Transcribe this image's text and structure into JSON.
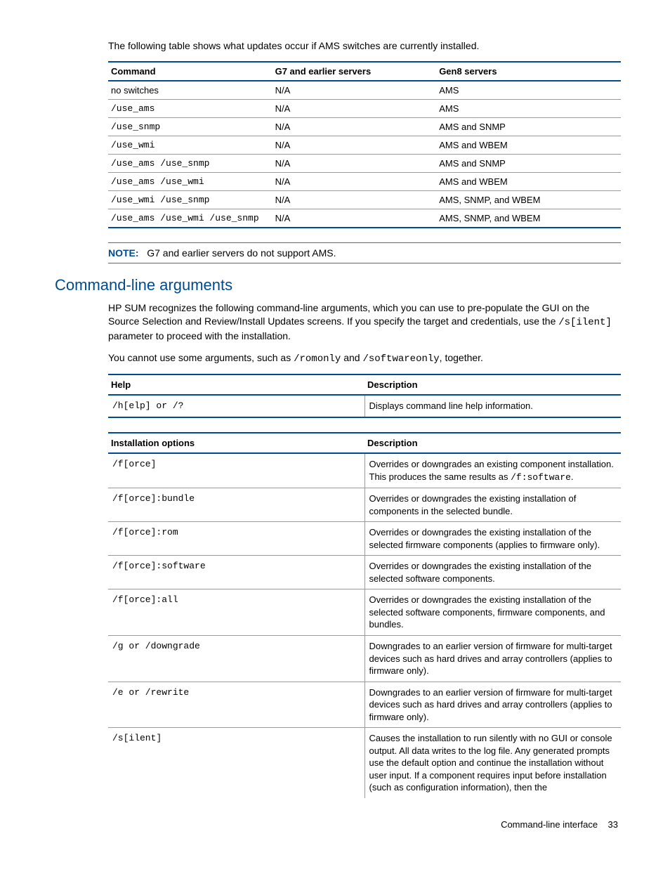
{
  "intro_text": "The following table shows what updates occur if AMS switches are currently installed.",
  "ams_table": {
    "headers": [
      "Command",
      "G7 and earlier servers",
      "Gen8 servers"
    ],
    "rows": [
      {
        "cmd": "no switches",
        "cmd_mono": false,
        "g7": "N/A",
        "gen8": "AMS"
      },
      {
        "cmd": "/use_ams",
        "cmd_mono": true,
        "g7": "N/A",
        "gen8": "AMS"
      },
      {
        "cmd": "/use_snmp",
        "cmd_mono": true,
        "g7": "N/A",
        "gen8": "AMS and SNMP"
      },
      {
        "cmd": "/use_wmi",
        "cmd_mono": true,
        "g7": "N/A",
        "gen8": "AMS and WBEM"
      },
      {
        "cmd": "/use_ams /use_snmp",
        "cmd_mono": true,
        "g7": "N/A",
        "gen8": "AMS and SNMP"
      },
      {
        "cmd": "/use_ams /use_wmi",
        "cmd_mono": true,
        "g7": "N/A",
        "gen8": "AMS and WBEM"
      },
      {
        "cmd": "/use_wmi /use_snmp",
        "cmd_mono": true,
        "g7": "N/A",
        "gen8": "AMS, SNMP, and WBEM"
      },
      {
        "cmd": "/use_ams /use_wmi /use_snmp",
        "cmd_mono": true,
        "g7": "N/A",
        "gen8": "AMS, SNMP, and WBEM"
      }
    ]
  },
  "note": {
    "label": "NOTE:",
    "text": "G7 and earlier servers do not support AMS."
  },
  "section_heading": "Command-line arguments",
  "para1_a": "HP SUM recognizes the following command-line arguments, which you can use to pre-populate the GUI on the Source Selection and Review/Install Updates screens. If you specify the target and credentials, use the ",
  "para1_code": "/s[ilent]",
  "para1_b": " parameter to proceed with the installation.",
  "para2_a": "You cannot use some arguments, such as ",
  "para2_code1": "/romonly",
  "para2_mid": " and ",
  "para2_code2": "/softwareonly",
  "para2_b": ", together.",
  "help_table": {
    "headers": [
      "Help",
      "Description"
    ],
    "rows": [
      {
        "arg": "/h[elp] or /?",
        "desc": "Displays command line help information."
      }
    ]
  },
  "install_table": {
    "headers": [
      "Installation options",
      "Description"
    ],
    "rows": [
      {
        "arg": "/f[orce]",
        "desc_a": "Overrides or downgrades an existing component installation. This produces the same results as ",
        "desc_code": "/f:software",
        "desc_b": "."
      },
      {
        "arg": "/f[orce]:bundle",
        "desc": "Overrides or downgrades the existing installation of components in the selected bundle."
      },
      {
        "arg": "/f[orce]:rom",
        "desc": "Overrides or downgrades the existing installation of the selected firmware components (applies to firmware only)."
      },
      {
        "arg": "/f[orce]:software",
        "desc": "Overrides or downgrades the existing installation of the selected software components."
      },
      {
        "arg": "/f[orce]:all",
        "desc": "Overrides or downgrades the existing installation of the selected software components, firmware components, and bundles."
      },
      {
        "arg": "/g or /downgrade",
        "desc": "Downgrades to an earlier version of firmware for multi-target devices such as hard drives and array controllers (applies to firmware only)."
      },
      {
        "arg": "/e or /rewrite",
        "desc": "Downgrades to an earlier version of firmware for multi-target devices such as hard drives and array controllers (applies to firmware only)."
      },
      {
        "arg": "/s[ilent]",
        "desc": "Causes the installation to run silently with no GUI or console output. All data writes to the log file. Any generated prompts use the default option and continue the installation without user input. If a component requires input before installation (such as configuration information), then the"
      }
    ]
  },
  "footer": {
    "label": "Command-line interface",
    "page": "33"
  }
}
